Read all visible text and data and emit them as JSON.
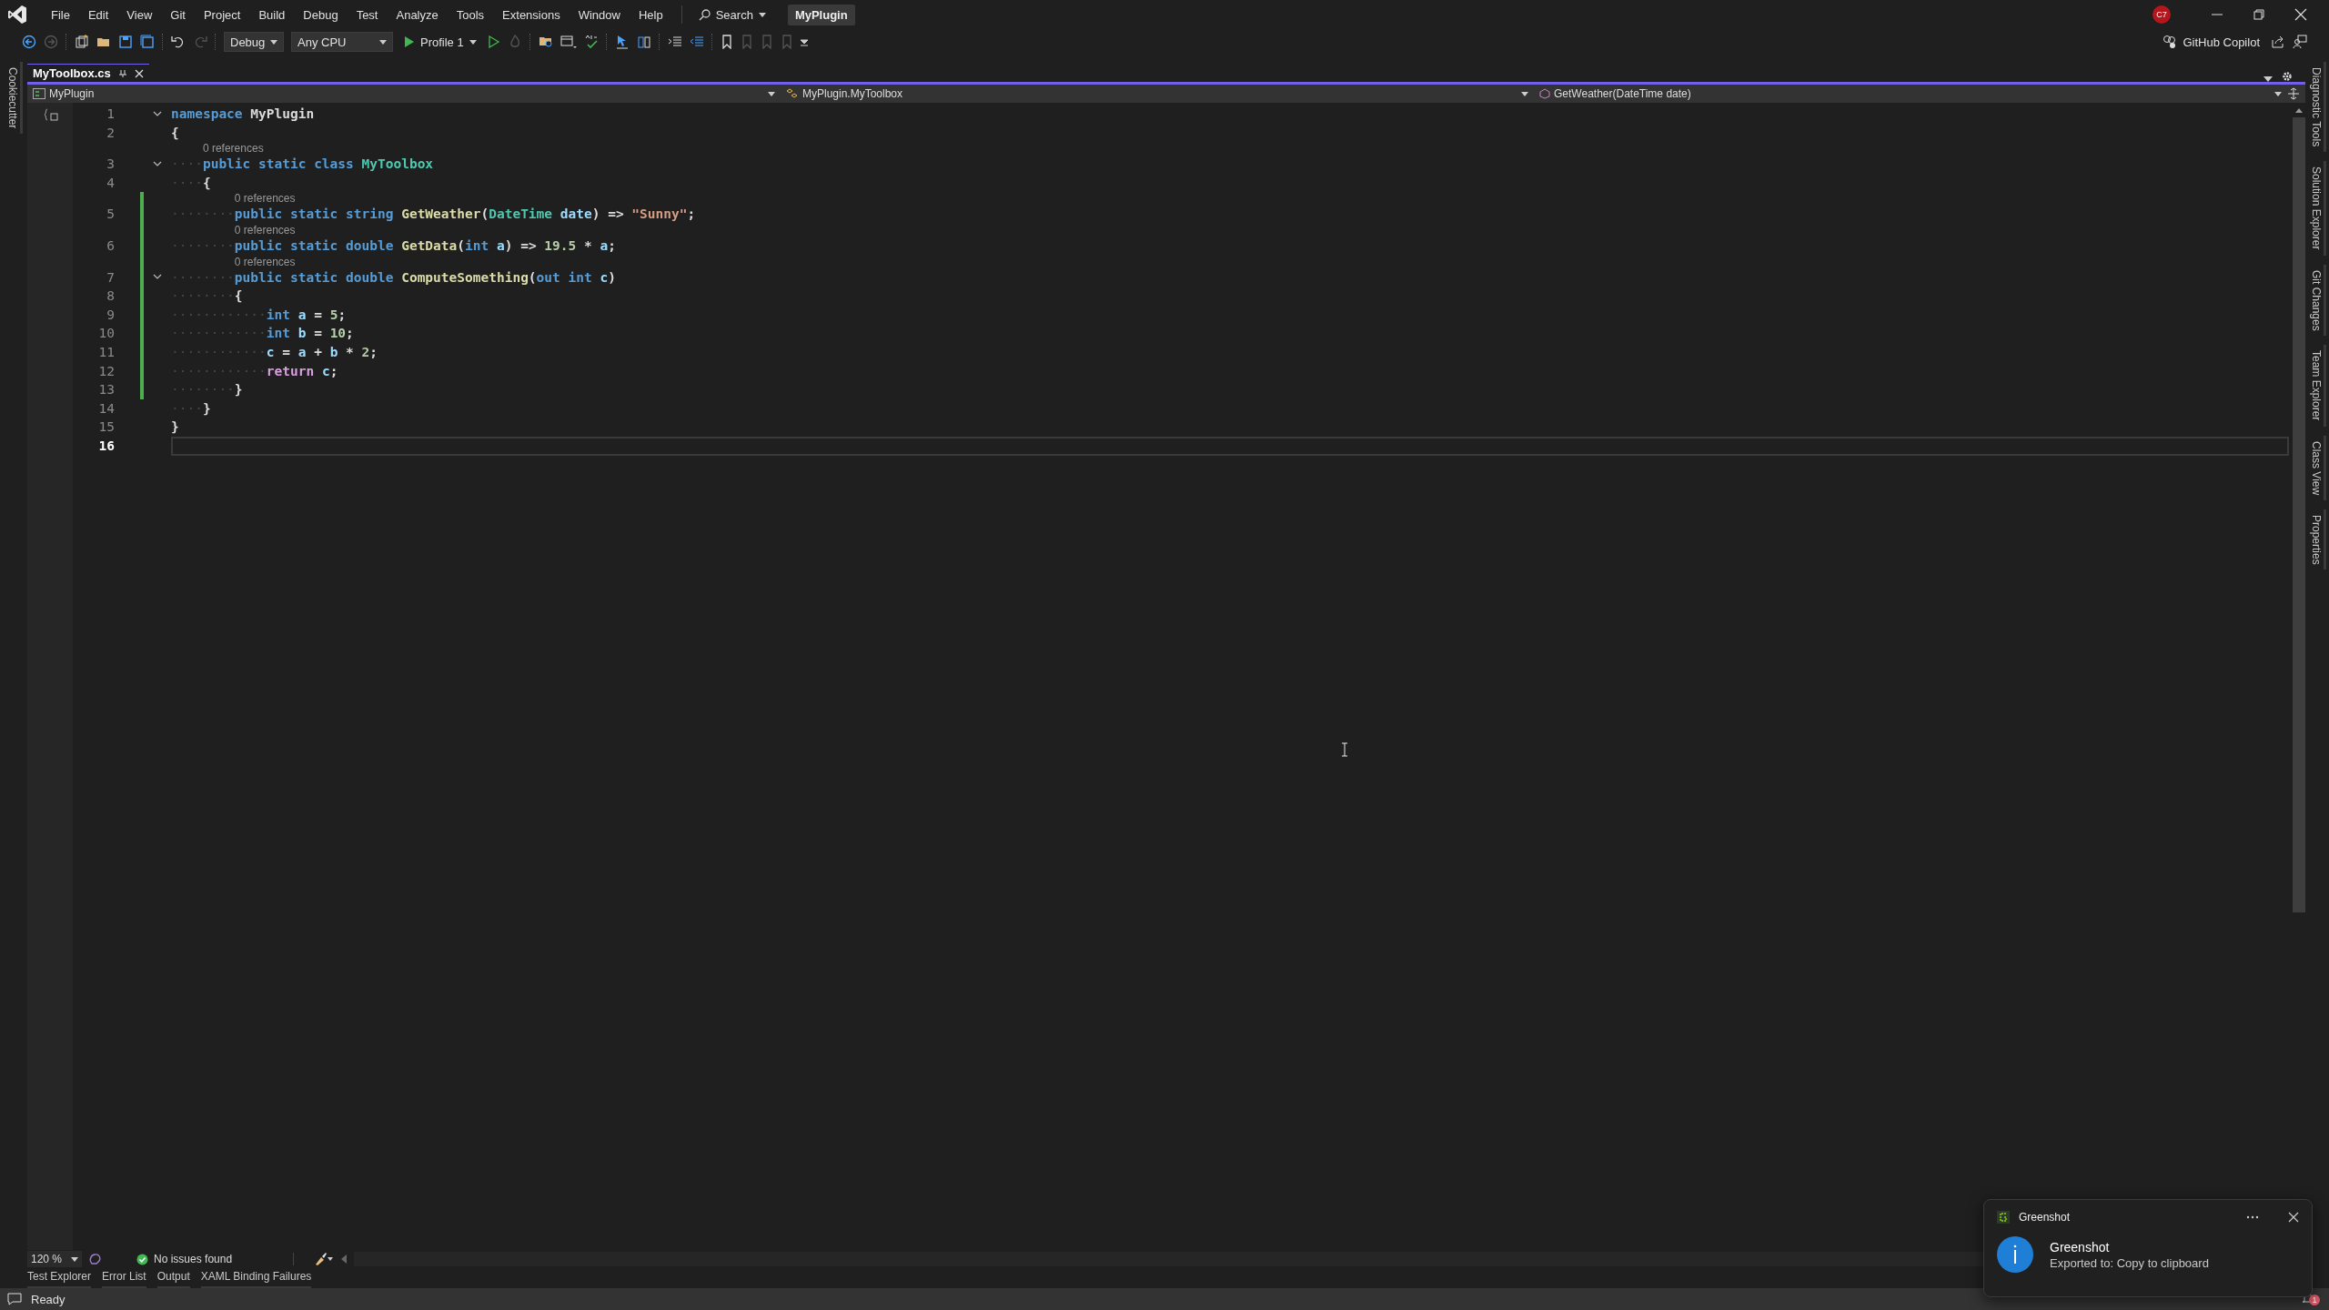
{
  "menu": [
    "File",
    "Edit",
    "View",
    "Git",
    "Project",
    "Build",
    "Debug",
    "Test",
    "Analyze",
    "Tools",
    "Extensions",
    "Window",
    "Help"
  ],
  "search": {
    "label": "Search"
  },
  "solution_title": "MyPlugin",
  "account_badge": "C7",
  "toolbar": {
    "configuration": "Debug",
    "platform": "Any CPU",
    "run_profile": "Profile 1"
  },
  "copilot": "GitHub Copilot",
  "left_tabs": [
    "Cookiecutter"
  ],
  "right_tabs": [
    "Diagnostic Tools",
    "Solution Explorer",
    "Git Changes",
    "Team Explorer",
    "Class View",
    "Properties"
  ],
  "tabs": [
    {
      "label": "MyToolbox.cs",
      "selected": true
    }
  ],
  "nav": {
    "project": "MyPlugin",
    "type": "MyPlugin.MyToolbox",
    "member": "GetWeather(DateTime date)"
  },
  "code": [
    {
      "num": "1",
      "fold": true,
      "changed": false,
      "current": false,
      "tokens": [
        {
          "t": "namespace",
          "color": "#569cd6"
        },
        {
          "t": " MyPlugin",
          "color": "#dcdcdc"
        }
      ]
    },
    {
      "num": "2",
      "fold": false,
      "changed": false,
      "current": false,
      "tokens": [
        {
          "t": "{",
          "color": "#dcdcdc"
        }
      ]
    },
    {
      "num": "3",
      "fold": true,
      "changed": false,
      "current": false,
      "lead": "····",
      "lens": "0 references",
      "tokens": [
        {
          "t": "public static class",
          "color": "#569cd6"
        },
        {
          "t": " MyToolbox",
          "color": "#4ec9b0"
        }
      ]
    },
    {
      "num": "4",
      "fold": false,
      "changed": false,
      "current": false,
      "lead": "····",
      "tokens": [
        {
          "t": "{",
          "color": "#dcdcdc"
        }
      ]
    },
    {
      "num": "5",
      "fold": false,
      "changed": true,
      "current": false,
      "lead": "········",
      "lens": "0 references",
      "tokens": [
        {
          "t": "public static string",
          "color": "#569cd6"
        },
        {
          "t": " GetWeather",
          "color": "#dcdcaa"
        },
        {
          "t": "(",
          "color": "#dcdcdc"
        },
        {
          "t": "DateTime",
          "color": "#4ec9b0"
        },
        {
          "t": " date",
          "color": "#9cdcfe"
        },
        {
          "t": ") =>",
          "color": "#dcdcdc"
        },
        {
          "t": " \"Sunny\"",
          "color": "#d69d85"
        },
        {
          "t": ";",
          "color": "#dcdcdc"
        }
      ]
    },
    {
      "num": "6",
      "fold": false,
      "changed": true,
      "current": false,
      "lead": "········",
      "lens": "0 references",
      "tokens": [
        {
          "t": "public static double",
          "color": "#569cd6"
        },
        {
          "t": " GetData",
          "color": "#dcdcaa"
        },
        {
          "t": "(",
          "color": "#dcdcdc"
        },
        {
          "t": "int",
          "color": "#569cd6"
        },
        {
          "t": " a",
          "color": "#9cdcfe"
        },
        {
          "t": ") =>",
          "color": "#dcdcdc"
        },
        {
          "t": " 19.5",
          "color": "#b5cea8"
        },
        {
          "t": " *",
          "color": "#dcdcdc"
        },
        {
          "t": " a",
          "color": "#9cdcfe"
        },
        {
          "t": ";",
          "color": "#dcdcdc"
        }
      ]
    },
    {
      "num": "7",
      "fold": true,
      "changed": true,
      "current": false,
      "lead": "········",
      "lens": "0 references",
      "tokens": [
        {
          "t": "public static double",
          "color": "#569cd6"
        },
        {
          "t": " ComputeSomething",
          "color": "#dcdcaa"
        },
        {
          "t": "(",
          "color": "#dcdcdc"
        },
        {
          "t": "out int",
          "color": "#569cd6"
        },
        {
          "t": " c",
          "color": "#9cdcfe"
        },
        {
          "t": ")",
          "color": "#dcdcdc"
        }
      ]
    },
    {
      "num": "8",
      "fold": false,
      "changed": true,
      "current": false,
      "lead": "········",
      "tokens": [
        {
          "t": "{",
          "color": "#dcdcdc"
        }
      ]
    },
    {
      "num": "9",
      "fold": false,
      "changed": true,
      "current": false,
      "lead": "············",
      "tokens": [
        {
          "t": "int",
          "color": "#569cd6"
        },
        {
          "t": " a",
          "color": "#9cdcfe"
        },
        {
          "t": " =",
          "color": "#dcdcdc"
        },
        {
          "t": " 5",
          "color": "#b5cea8"
        },
        {
          "t": ";",
          "color": "#dcdcdc"
        }
      ]
    },
    {
      "num": "10",
      "fold": false,
      "changed": true,
      "current": false,
      "lead": "············",
      "tokens": [
        {
          "t": "int",
          "color": "#569cd6"
        },
        {
          "t": " b",
          "color": "#9cdcfe"
        },
        {
          "t": " =",
          "color": "#dcdcdc"
        },
        {
          "t": " 10",
          "color": "#b5cea8"
        },
        {
          "t": ";",
          "color": "#dcdcdc"
        }
      ]
    },
    {
      "num": "11",
      "fold": false,
      "changed": true,
      "current": false,
      "lead": "············",
      "tokens": [
        {
          "t": "c",
          "color": "#9cdcfe"
        },
        {
          "t": " =",
          "color": "#dcdcdc"
        },
        {
          "t": " a",
          "color": "#9cdcfe"
        },
        {
          "t": " +",
          "color": "#dcdcdc"
        },
        {
          "t": " b",
          "color": "#9cdcfe"
        },
        {
          "t": " *",
          "color": "#dcdcdc"
        },
        {
          "t": " 2",
          "color": "#b5cea8"
        },
        {
          "t": ";",
          "color": "#dcdcdc"
        }
      ]
    },
    {
      "num": "12",
      "fold": false,
      "changed": true,
      "current": false,
      "lead": "············",
      "tokens": [
        {
          "t": "return",
          "color": "#d8a0df"
        },
        {
          "t": " c",
          "color": "#9cdcfe"
        },
        {
          "t": ";",
          "color": "#dcdcdc"
        }
      ]
    },
    {
      "num": "13",
      "fold": false,
      "changed": true,
      "current": false,
      "lead": "········",
      "tokens": [
        {
          "t": "}",
          "color": "#dcdcdc"
        }
      ]
    },
    {
      "num": "14",
      "fold": false,
      "changed": false,
      "current": false,
      "lead": "····",
      "tokens": [
        {
          "t": "}",
          "color": "#dcdcdc"
        }
      ]
    },
    {
      "num": "15",
      "fold": false,
      "changed": false,
      "current": false,
      "tokens": [
        {
          "t": "}",
          "color": "#dcdcdc"
        }
      ]
    },
    {
      "num": "16",
      "fold": false,
      "changed": false,
      "current": true
    }
  ],
  "editor_status": {
    "zoom": "120 %",
    "issues": "No issues found"
  },
  "bottom_tabs": [
    "Test Explorer",
    "Error List",
    "Output",
    "XAML Binding Failures"
  ],
  "status": "Ready",
  "notification_count": "1",
  "toast": {
    "app": "Greenshot",
    "title": "Greenshot",
    "message": "Exported to: Copy to clipboard"
  }
}
